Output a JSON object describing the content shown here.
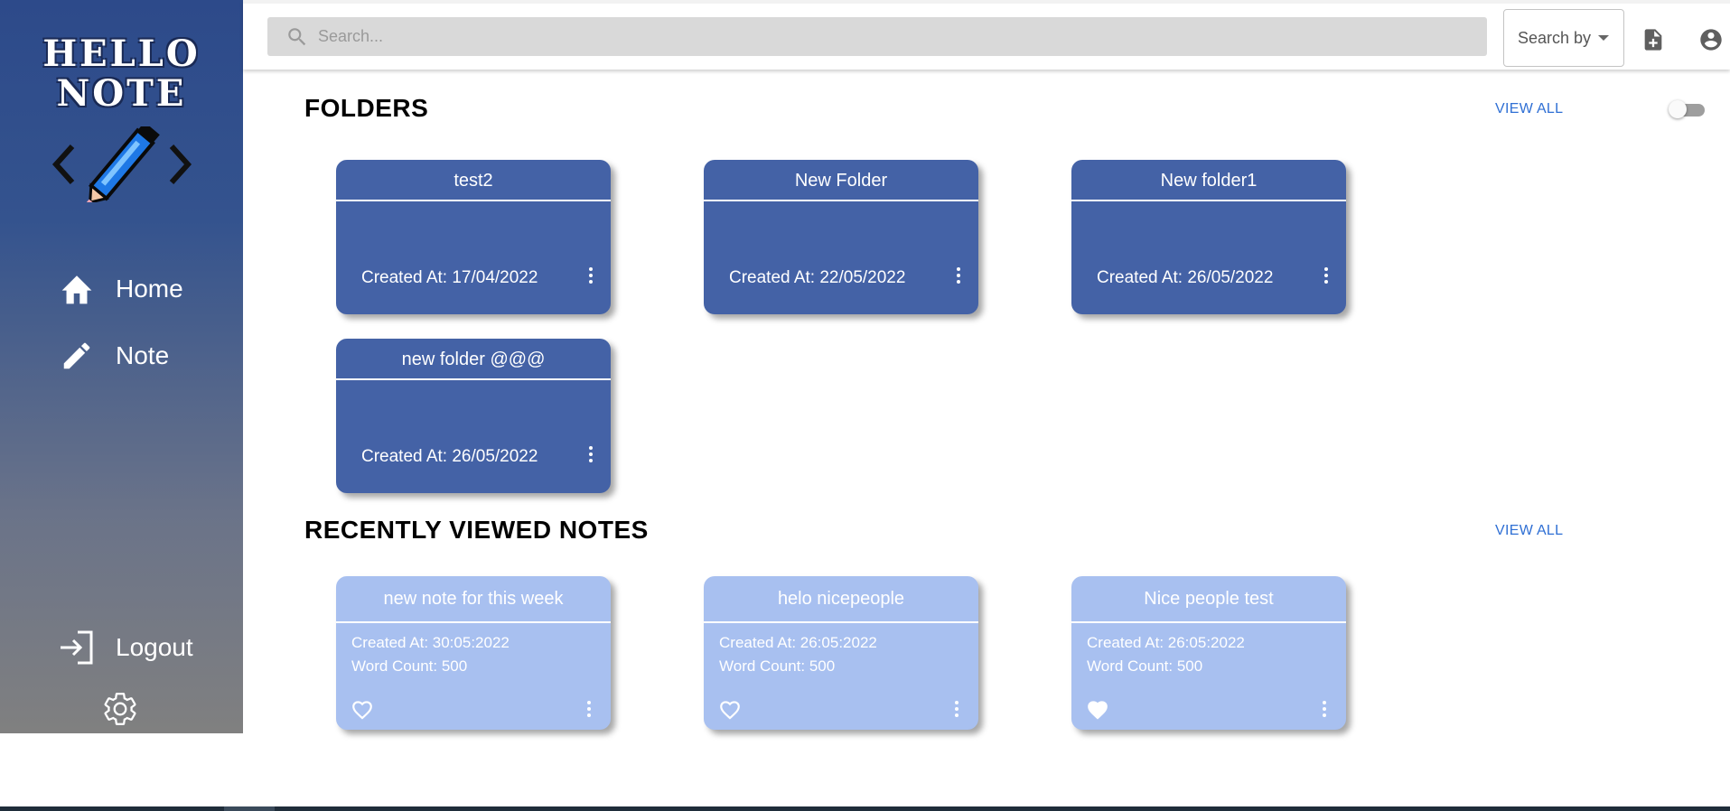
{
  "sidebar": {
    "logo_line1": "HELLO",
    "logo_line2": "NOTE",
    "nav": [
      {
        "label": "Home",
        "icon": "home-icon"
      },
      {
        "label": "Note",
        "icon": "pencil-icon"
      }
    ],
    "logout_label": "Logout",
    "settings_icon": "gear-icon"
  },
  "topbar": {
    "search_placeholder": "Search...",
    "search_by_label": "Search by",
    "icons": [
      "add-note-icon",
      "account-icon"
    ]
  },
  "folders": {
    "title": "FOLDERS",
    "view_all": "VIEW ALL",
    "items": [
      {
        "name": "test2",
        "created": "Created At: 17/04/2022"
      },
      {
        "name": "New Folder",
        "created": "Created At: 22/05/2022"
      },
      {
        "name": "New folder1",
        "created": "Created At: 26/05/2022"
      },
      {
        "name": "new folder @@@",
        "created": "Created At: 26/05/2022"
      }
    ]
  },
  "notes": {
    "title": "RECENTLY VIEWED NOTES",
    "view_all": "VIEW ALL",
    "items": [
      {
        "name": "new note for this week",
        "created": "Created At: 30:05:2022",
        "words": "Word Count: 500",
        "favorite": false
      },
      {
        "name": "helo nicepeople",
        "created": "Created At: 26:05:2022",
        "words": "Word Count: 500",
        "favorite": false
      },
      {
        "name": "Nice people test",
        "created": "Created At: 26:05:2022",
        "words": "Word Count: 500",
        "favorite": true
      }
    ]
  },
  "colors": {
    "folder_card": "#4462a6",
    "note_card": "#a8c0f0",
    "link": "#2f6fd4",
    "sidebar_top": "#2d4a8a",
    "sidebar_bottom": "#808080"
  }
}
